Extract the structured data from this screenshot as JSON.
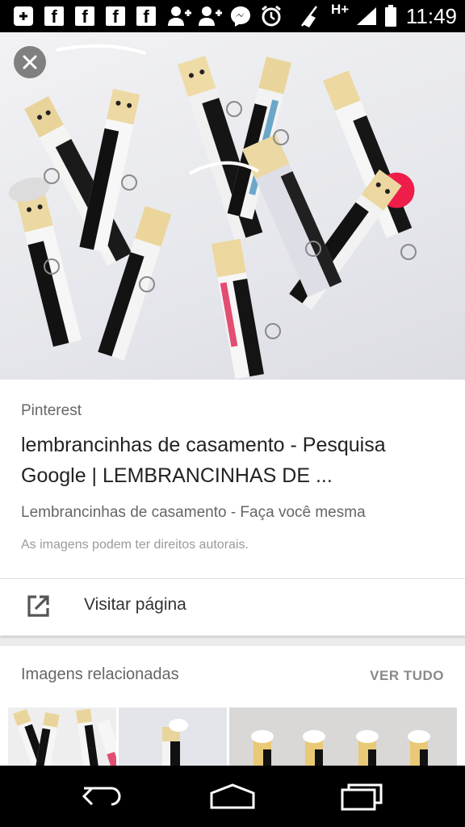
{
  "status_bar": {
    "facebook_letter": "f",
    "network": "H+",
    "time": "11:49",
    "icons": [
      "add-icon",
      "facebook-icon",
      "facebook-icon",
      "facebook-icon",
      "facebook-icon",
      "add-contact-icon",
      "add-contact-icon",
      "messenger-icon",
      "alarm-icon",
      "mute-icon",
      "signal-icon",
      "battery-icon"
    ]
  },
  "hero": {
    "close_icon": "close-icon"
  },
  "info": {
    "source": "Pinterest",
    "title": "lembrancinhas de casamento - Pesquisa Google | LEMBRANCINHAS DE ...",
    "description": "Lembrancinhas de casamento - Faça você mesma",
    "copyright": "As imagens podem ter direitos autorais."
  },
  "visit": {
    "label": "Visitar página",
    "icon": "open-in-new-icon"
  },
  "related": {
    "title": "Imagens relacionadas",
    "see_all": "VER TUDO"
  },
  "nav": {
    "icons": [
      "back-icon",
      "home-icon",
      "recent-apps-icon"
    ]
  },
  "colors": {
    "status_bar": "#000000",
    "card": "#ffffff",
    "page_bg": "#ececec",
    "primary_text": "#222222",
    "secondary_text": "#666666"
  }
}
